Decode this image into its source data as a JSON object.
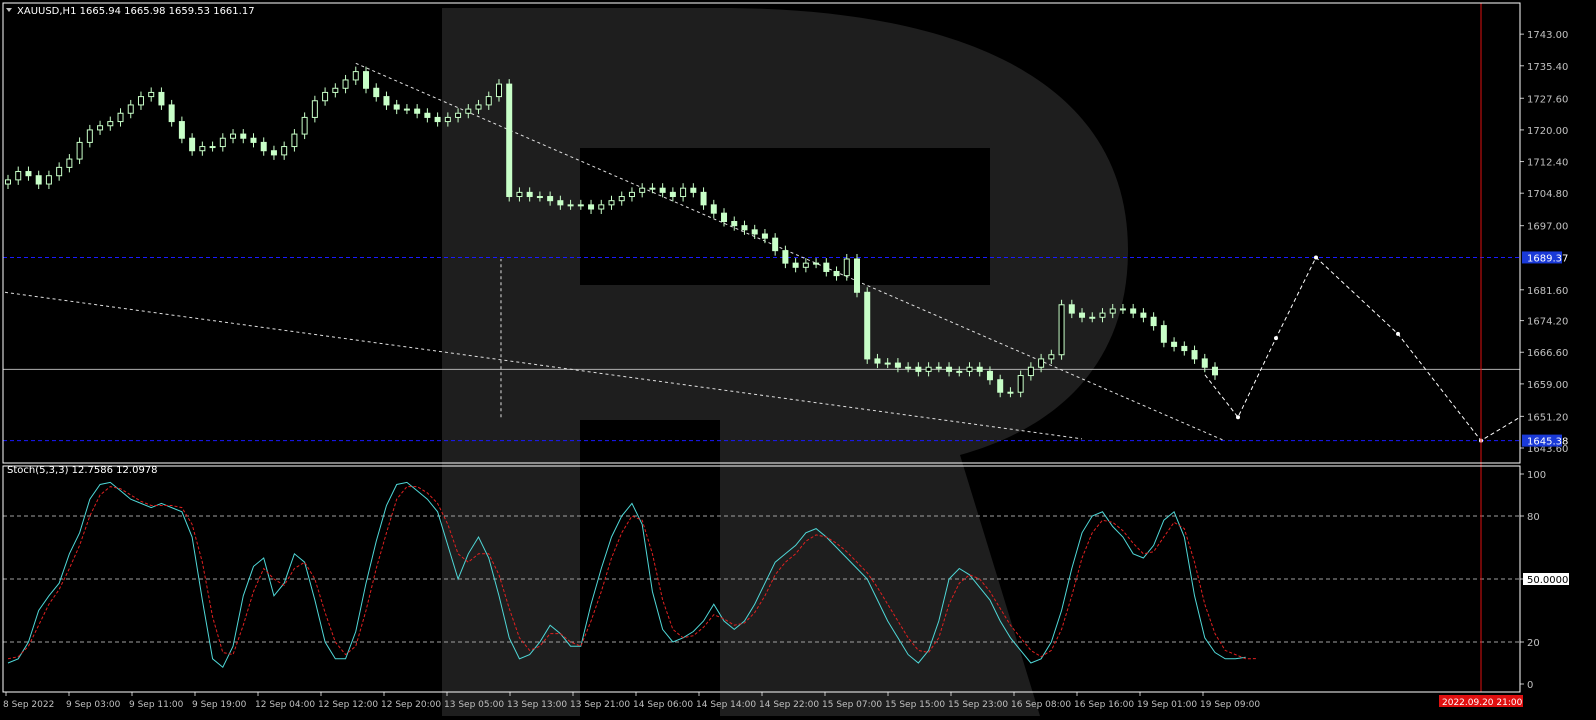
{
  "header": {
    "symbol_line": "XAUUSD,H1  1665.94 1665.98 1659.53 1661.17",
    "indicator_line": "Stoch(5,3,3) 12.7586 12.0978"
  },
  "colors": {
    "background": "#000000",
    "candle": "#c8ffc8",
    "grid_level": "#1a1aff",
    "stoch_main": "#4fd7d7",
    "stoch_signal": "#e02020",
    "red_marker": "#e01010",
    "label_blue_bg": "#1a3ad8"
  },
  "icons": {
    "menu": "triangle-down-icon"
  },
  "chart_data": [
    {
      "type": "candlestick",
      "title": "XAUUSD,H1",
      "ylim": [
        1640,
        1750
      ],
      "price_ticks": [
        "1743.00",
        "1735.40",
        "1727.60",
        "1720.00",
        "1712.40",
        "1704.80",
        "1697.00",
        "1681.60",
        "1674.20",
        "1666.60",
        "1659.00",
        "1651.20",
        "1643.60"
      ],
      "price_tick_values": [
        1743.0,
        1735.4,
        1727.6,
        1720.0,
        1712.4,
        1704.8,
        1697.0,
        1681.6,
        1674.2,
        1666.6,
        1659.0,
        1651.2,
        1643.6
      ],
      "level_lines": [
        {
          "value": 1689.37,
          "label": "1689.37",
          "style": "dashed-blue"
        },
        {
          "value": 1662.5,
          "label": "",
          "style": "solid-gray"
        },
        {
          "value": 1645.38,
          "label": "1645.38",
          "style": "dashed-blue"
        }
      ],
      "closes": [
        1708,
        1710,
        1709,
        1707,
        1709,
        1711,
        1713,
        1717,
        1720,
        1721,
        1722,
        1724,
        1726,
        1728,
        1729,
        1726,
        1722,
        1718,
        1715,
        1716,
        1716,
        1718,
        1719,
        1718,
        1717,
        1715,
        1714,
        1716,
        1719,
        1723,
        1727,
        1729,
        1730,
        1732,
        1734,
        1730,
        1728,
        1726,
        1725,
        1725,
        1724,
        1723,
        1722,
        1723,
        1724,
        1725,
        1726,
        1728,
        1731,
        1704,
        1705,
        1704,
        1704,
        1703,
        1702,
        1702,
        1702,
        1701,
        1702,
        1703,
        1704,
        1705,
        1706,
        1706,
        1705,
        1704,
        1706,
        1705,
        1702,
        1700,
        1698,
        1697,
        1696,
        1695,
        1694,
        1691,
        1688,
        1687,
        1688,
        1688,
        1686,
        1685,
        1689,
        1681,
        1665,
        1664,
        1664,
        1663,
        1663,
        1662,
        1663,
        1663,
        1662,
        1662,
        1663,
        1662,
        1660,
        1657,
        1657,
        1661,
        1663,
        1665,
        1666,
        1678,
        1676,
        1675,
        1675,
        1676,
        1677,
        1677,
        1676,
        1675,
        1673,
        1669,
        1668,
        1667,
        1665,
        1663,
        1661.17
      ],
      "drawn_forecast": "dashed white path: 1651 -> 1689.37 -> 1645.38 -> 1651"
    },
    {
      "type": "line",
      "title": "Stoch(5,3,3)",
      "ylim": [
        0,
        100
      ],
      "ticks": [
        "100",
        "80",
        "50.0000",
        "20",
        "0"
      ],
      "tick_values": [
        100,
        80,
        50,
        20,
        0
      ],
      "levels": [
        80,
        50,
        20
      ],
      "series": [
        {
          "name": "",
          "color": "#4fd7d7",
          "values": [
            10,
            12,
            20,
            35,
            42,
            48,
            62,
            72,
            88,
            95,
            96,
            92,
            88,
            86,
            84,
            86,
            84,
            82,
            70,
            40,
            12,
            8,
            18,
            42,
            56,
            60,
            42,
            48,
            62,
            58,
            40,
            20,
            12,
            12,
            25,
            48,
            68,
            85,
            95,
            96,
            92,
            88,
            82,
            66,
            50,
            62,
            70,
            60,
            42,
            22,
            12,
            14,
            20,
            28,
            24,
            18,
            18,
            38,
            55,
            70,
            80,
            86,
            76,
            44,
            26,
            20,
            22,
            25,
            30,
            38,
            30,
            26,
            30,
            38,
            48,
            58,
            62,
            66,
            72,
            74,
            70,
            65,
            60,
            55,
            50,
            40,
            30,
            22,
            14,
            10,
            16,
            30,
            50,
            55,
            52,
            46,
            40,
            30,
            22,
            16,
            10,
            12,
            20,
            35,
            55,
            72,
            80,
            82,
            75,
            70,
            62,
            60,
            66,
            78,
            82,
            70,
            42,
            22,
            15,
            12,
            12,
            12.76
          ]
        },
        {
          "name": "",
          "color": "#e02020",
          "values": [
            12,
            13,
            18,
            28,
            38,
            45,
            55,
            66,
            80,
            90,
            94,
            93,
            90,
            87,
            85,
            85,
            85,
            84,
            76,
            58,
            32,
            15,
            14,
            28,
            44,
            55,
            50,
            47,
            55,
            58,
            50,
            34,
            20,
            14,
            18,
            35,
            55,
            72,
            88,
            94,
            94,
            91,
            86,
            76,
            62,
            58,
            62,
            62,
            52,
            36,
            22,
            16,
            18,
            24,
            24,
            20,
            18,
            30,
            44,
            60,
            72,
            80,
            78,
            62,
            40,
            26,
            22,
            23,
            27,
            33,
            31,
            28,
            29,
            34,
            42,
            52,
            58,
            62,
            68,
            71,
            70,
            67,
            63,
            58,
            53,
            46,
            38,
            30,
            22,
            16,
            15,
            22,
            38,
            48,
            52,
            50,
            44,
            36,
            28,
            22,
            16,
            13,
            16,
            26,
            42,
            60,
            72,
            78,
            77,
            73,
            67,
            62,
            63,
            70,
            77,
            74,
            58,
            38,
            24,
            16,
            14,
            12,
            12.1
          ]
        }
      ],
      "x_ticks": [
        "8 Sep 2022",
        "9 Sep 03:00",
        "9 Sep 11:00",
        "9 Sep 19:00",
        "12 Sep 04:00",
        "12 Sep 12:00",
        "12 Sep 20:00",
        "13 Sep 05:00",
        "13 Sep 13:00",
        "13 Sep 21:00",
        "14 Sep 06:00",
        "14 Sep 14:00",
        "14 Sep 22:00",
        "15 Sep 07:00",
        "15 Sep 15:00",
        "15 Sep 23:00",
        "16 Sep 08:00",
        "16 Sep 16:00",
        "19 Sep 01:00",
        "19 Sep 09:00"
      ],
      "time_marker": "2022.09.20 21:00"
    }
  ]
}
